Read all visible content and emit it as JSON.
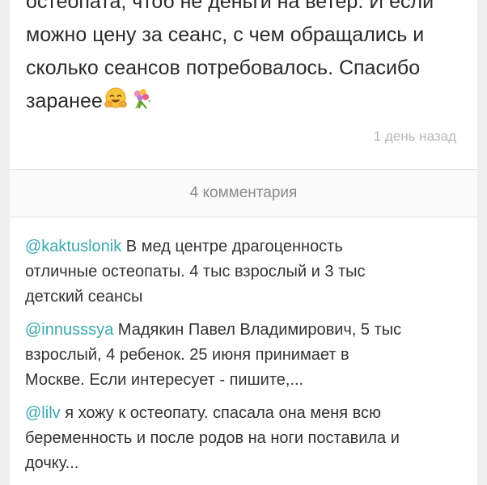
{
  "post": {
    "lines": [
      "остеопата, чтоб не деньги на ветер. И если",
      "можно цену за сеанс, с чем обращались и",
      "сколько сеансов потребовалось. Спасибо",
      "заранее"
    ],
    "emoji_icons": [
      "hugging-face-emoji",
      "bouquet-emoji"
    ],
    "timestamp": "1 день назад"
  },
  "comments_header": {
    "label": "4 комментария"
  },
  "comments": [
    {
      "username": "@kaktuslonik",
      "lines": [
        " В мед центре драгоценность",
        "отличные остеопаты. 4 тыс взрослый и 3 тыс",
        "детский сеансы"
      ]
    },
    {
      "username": "@innusssya",
      "lines": [
        " Мадякин Павел Владимирович, 5 тыс",
        "взрослый, 4 ребенок. 25 июня принимает в",
        "Москве. Если интересует - пишите,..."
      ]
    },
    {
      "username": "@lilv",
      "lines": [
        " я хожу к остеопату. спасала она меня всю",
        "беременность и после родов на ноги поставила и",
        "дочку..."
      ]
    }
  ],
  "colors": {
    "background": "#eeeeee",
    "card": "#ffffff",
    "username": "#3aa7b0",
    "text": "#2b2b2b",
    "muted": "#b8b8b8",
    "header_text": "#8a8a8a"
  }
}
